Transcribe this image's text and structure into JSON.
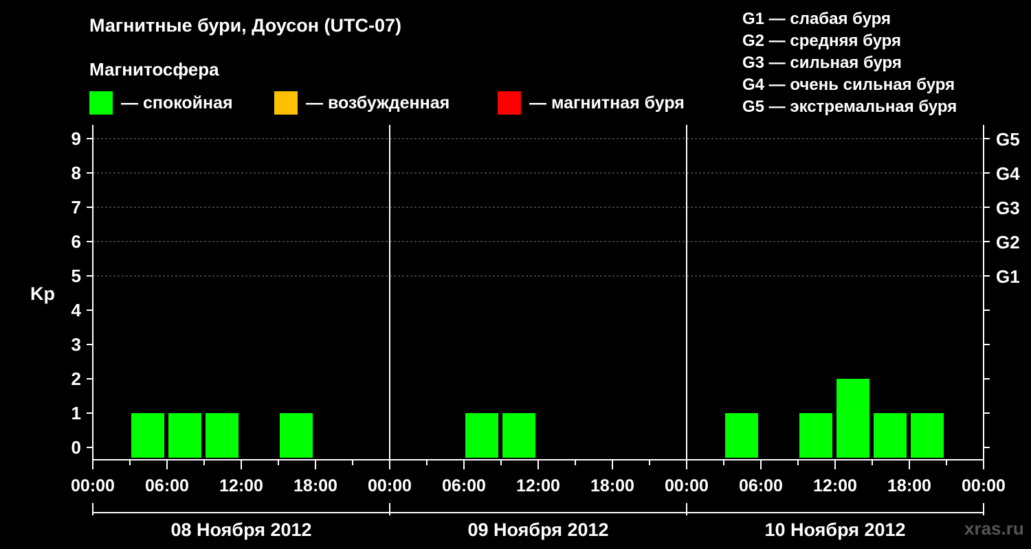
{
  "header": {
    "title": "Магнитные бури, Доусон (UTC-07)",
    "subtitle": "Магнитосфера"
  },
  "legend": {
    "items": [
      {
        "label": "— спокойная",
        "color": "#00ff00"
      },
      {
        "label": "— возбужденная",
        "color": "#ffc000"
      },
      {
        "label": "— магнитная буря",
        "color": "#ff0000"
      }
    ]
  },
  "storm_scale": [
    "G1 — слабая буря",
    "G2 — средняя буря",
    "G3 — сильная буря",
    "G4 — очень сильная буря",
    "G5 — экстремальная буря"
  ],
  "watermark": "xras.ru",
  "chart_data": {
    "type": "bar",
    "ylabel": "Kp",
    "ylim": [
      0,
      9
    ],
    "yticks": [
      "0",
      "1",
      "2",
      "3",
      "4",
      "5",
      "6",
      "7",
      "8",
      "9"
    ],
    "right_ticks": [
      {
        "value": 5,
        "label": "G1"
      },
      {
        "value": 6,
        "label": "G2"
      },
      {
        "value": 7,
        "label": "G3"
      },
      {
        "value": 8,
        "label": "G4"
      },
      {
        "value": 9,
        "label": "G5"
      }
    ],
    "grid": "dashed horizontal at Kp 5-9",
    "xtick_labels": [
      "00:00",
      "06:00",
      "12:00",
      "18:00",
      "00:00",
      "06:00",
      "12:00",
      "18:00",
      "00:00",
      "06:00",
      "12:00",
      "18:00",
      "00:00"
    ],
    "days": [
      "08 Ноября 2012",
      "09 Ноября 2012",
      "10 Ноября 2012"
    ],
    "bar_color": "#00ff00",
    "kp": [
      [
        0,
        1,
        1,
        1,
        0,
        1,
        0,
        0
      ],
      [
        0,
        0,
        1,
        1,
        0,
        0,
        0,
        0
      ],
      [
        0,
        1,
        0,
        1,
        2,
        1,
        1,
        0
      ]
    ]
  }
}
